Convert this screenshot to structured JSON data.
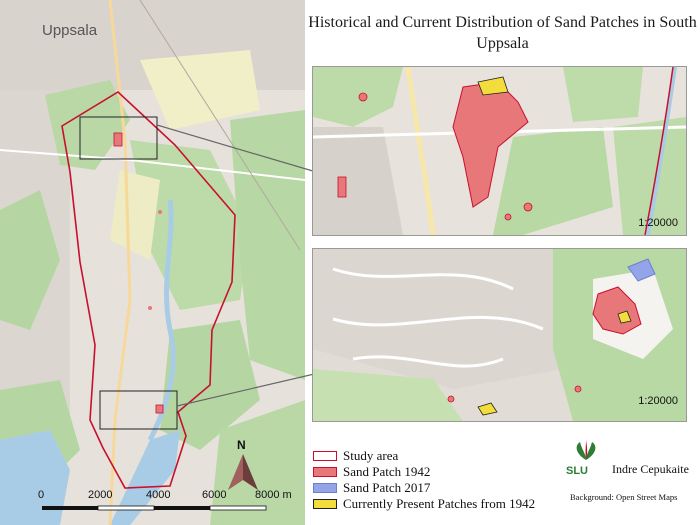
{
  "title": "Historical and Current Distribution of Sand Patches in South Uppsala",
  "city_label": "Uppsala",
  "north_label": "N",
  "scale_bar": {
    "ticks": [
      "0",
      "2000",
      "4000",
      "6000",
      "8000 m"
    ]
  },
  "insets": [
    {
      "scale": "1:20000"
    },
    {
      "scale": "1:20000"
    }
  ],
  "legend": {
    "items": [
      {
        "label": "Study area",
        "fill": "#ffffff",
        "stroke": "#c8102e"
      },
      {
        "label": "Sand Patch 1942",
        "fill": "#e8777a",
        "stroke": "#c8102e"
      },
      {
        "label": "Sand Patch 2017",
        "fill": "#93a4e8",
        "stroke": "#6c7fd0"
      },
      {
        "label": "Currently Present Patches from 1942",
        "fill": "#f2dd3c",
        "stroke": "#222222"
      }
    ]
  },
  "credit": {
    "logo_text": "SLU",
    "author": "Indre Cepukaite",
    "background": "Background: Open Street Maps"
  },
  "colors": {
    "study_area": "#c8102e",
    "forest": "#b5d6a3",
    "water": "#a9cce6",
    "urban": "#d8d2cc"
  }
}
